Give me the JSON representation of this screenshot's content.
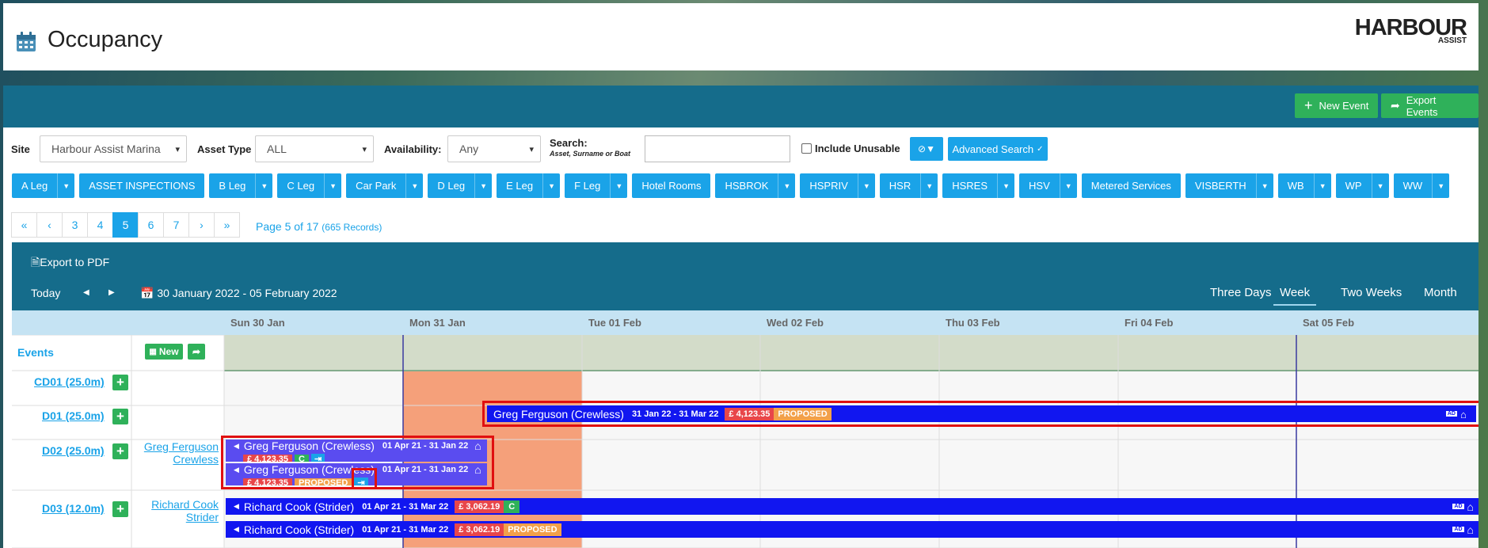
{
  "header": {
    "title": "Occupancy",
    "logo_main": "HARBOUR",
    "logo_sub": "ASSIST"
  },
  "actions": {
    "new_event": "New Event",
    "export_events": "Export Events"
  },
  "filters": {
    "site_label": "Site",
    "site_value": "Harbour Assist Marina",
    "asset_type_label": "Asset Type",
    "asset_type_value": "ALL",
    "availability_label": "Availability:",
    "availability_value": "Any",
    "search_label": "Search:",
    "search_hint": "Asset, Surname or Boat",
    "search_value": "",
    "include_unusable": "Include Unusable",
    "advanced_search": "Advanced Search"
  },
  "tabs": [
    {
      "label": "A Leg",
      "caret": true
    },
    {
      "label": "ASSET INSPECTIONS",
      "caret": false
    },
    {
      "label": "B Leg",
      "caret": true
    },
    {
      "label": "C Leg",
      "caret": true
    },
    {
      "label": "Car Park",
      "caret": true
    },
    {
      "label": "D Leg",
      "caret": true
    },
    {
      "label": "E Leg",
      "caret": true
    },
    {
      "label": "F Leg",
      "caret": true
    },
    {
      "label": "Hotel Rooms",
      "caret": false
    },
    {
      "label": "HSBROK",
      "caret": true
    },
    {
      "label": "HSPRIV",
      "caret": true
    },
    {
      "label": "HSR",
      "caret": true
    },
    {
      "label": "HSRES",
      "caret": true
    },
    {
      "label": "HSV",
      "caret": true
    },
    {
      "label": "Metered Services",
      "caret": false
    },
    {
      "label": "VISBERTH",
      "caret": true
    },
    {
      "label": "WB",
      "caret": true
    },
    {
      "label": "WP",
      "caret": true
    },
    {
      "label": "WW",
      "caret": true
    }
  ],
  "pagination": {
    "items": [
      "«",
      "‹",
      "3",
      "4",
      "5",
      "6",
      "7",
      "›",
      "»"
    ],
    "current": "5",
    "info": "Page 5 of 17",
    "records": "(665 Records)"
  },
  "scheduler": {
    "export_pdf": "Export to PDF",
    "today": "Today",
    "prev": "◀",
    "next": "▶",
    "date_range": "30 January 2022 - 05 February 2022",
    "views": [
      "Three Days",
      "Week",
      "Two Weeks",
      "Month"
    ],
    "active_view": "Week",
    "days": [
      "Sun 30 Jan",
      "Mon 31 Jan",
      "Tue 01 Feb",
      "Wed 02 Feb",
      "Thu 03 Feb",
      "Fri 04 Feb",
      "Sat 05 Feb"
    ],
    "events_label": "Events",
    "new_label": "New",
    "rows": [
      {
        "asset": "CD01 (25.0m)",
        "owner": ""
      },
      {
        "asset": "D01 (25.0m)",
        "owner": ""
      },
      {
        "asset": "D02 (25.0m)",
        "owner": "Greg Ferguson Crewless",
        "owner_line1": "Greg Ferguson",
        "owner_line2": "Crewless"
      },
      {
        "asset": "D03 (12.0m)",
        "owner": "Richard Cook Strider",
        "owner_line1": "Richard Cook",
        "owner_line2": "Strider"
      }
    ],
    "bookings": [
      {
        "name": "Greg Ferguson (Crewless)",
        "dates": "31 Jan 22 - 31 Mar 22",
        "price": "£ 4,123.35",
        "status": "PROPOSED"
      },
      {
        "name": "Greg Ferguson (Crewless)",
        "dates": "01 Apr 21 - 31 Jan 22",
        "price": "£ 4,123.35",
        "status": "C"
      },
      {
        "name": "Greg Ferguson (Crewless)",
        "dates": "01 Apr 21 - 31 Jan 22",
        "price": "£ 4,123.35",
        "status": "PROPOSED"
      },
      {
        "name": "Richard Cook (Strider)",
        "dates": "01 Apr 21 - 31 Mar 22",
        "price": "£ 3,062.19",
        "status": "C"
      },
      {
        "name": "Richard Cook (Strider)",
        "dates": "01 Apr 21 - 31 Mar 22",
        "price": "£ 3,062.19",
        "status": "PROPOSED"
      }
    ],
    "ad_badge": "AD"
  },
  "colors": {
    "teal": "#156c8b",
    "accent": "#1aa3e8",
    "green": "#2fb15a",
    "booking_blue": "#1116f0",
    "highlight_orange": "#f5a07a"
  }
}
